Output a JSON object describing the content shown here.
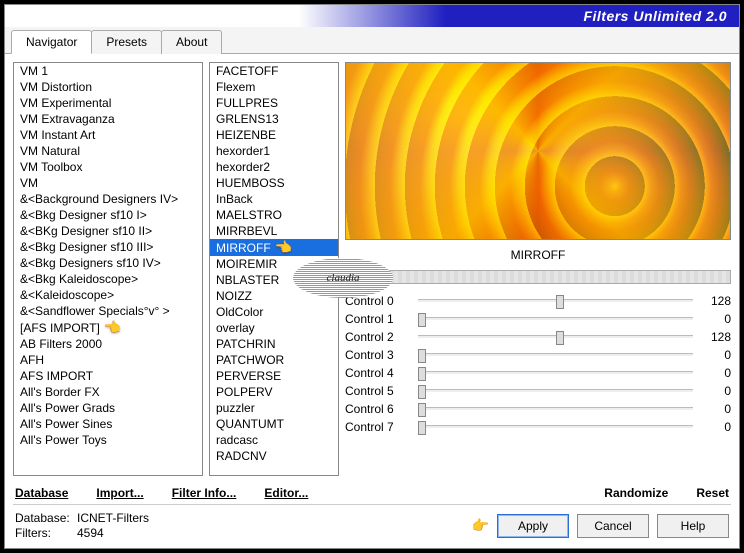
{
  "title": "Filters Unlimited 2.0",
  "tabs": {
    "navigator": "Navigator",
    "presets": "Presets",
    "about": "About"
  },
  "left_list": [
    "VM 1",
    "VM Distortion",
    "VM Experimental",
    "VM Extravaganza",
    "VM Instant Art",
    "VM Natural",
    "VM Toolbox",
    "VM",
    "&<Background Designers IV>",
    "&<Bkg Designer sf10 I>",
    "&<BKg Designer sf10 II>",
    "&<Bkg Designer sf10 III>",
    "&<Bkg Designers sf10 IV>",
    "&<Bkg Kaleidoscope>",
    "&<Kaleidoscope>",
    "&<Sandflower Specials°v° >",
    "[AFS IMPORT]",
    "AB Filters 2000",
    "AFH",
    "AFS IMPORT",
    "All's Border FX",
    "All's Power Grads",
    "All's Power Sines",
    "All's Power Toys"
  ],
  "left_pointer_index": 16,
  "mid_list": [
    "FACETOFF",
    "Flexem",
    "FULLPRES",
    "GRLENS13",
    "HEIZENBE",
    "hexorder1",
    "hexorder2",
    "HUEMBOSS",
    "InBack",
    "MAELSTRO",
    "MIRRBEVL",
    "MIRROFF",
    "MOIREMIR",
    "NBLASTER",
    "NOIZZ",
    "OldColor",
    "overlay",
    "PATCHRIN",
    "PATCHWOR",
    "PERVERSE",
    "POLPERV",
    "puzzler",
    "QUANTUMT",
    "radcasc",
    "RADCNV"
  ],
  "mid_selected_index": 11,
  "filter_name": "MIRROFF",
  "controls": [
    {
      "label": "Control 0",
      "value": 128,
      "pos": 50
    },
    {
      "label": "Control 1",
      "value": 0,
      "pos": 0
    },
    {
      "label": "Control 2",
      "value": 128,
      "pos": 50
    },
    {
      "label": "Control 3",
      "value": 0,
      "pos": 0
    },
    {
      "label": "Control 4",
      "value": 0,
      "pos": 0
    },
    {
      "label": "Control 5",
      "value": 0,
      "pos": 0
    },
    {
      "label": "Control 6",
      "value": 0,
      "pos": 0
    },
    {
      "label": "Control 7",
      "value": 0,
      "pos": 0
    }
  ],
  "linkbar": {
    "database": "Database",
    "import": "Import...",
    "filter_info": "Filter Info...",
    "editor": "Editor...",
    "randomize": "Randomize",
    "reset": "Reset"
  },
  "footer": {
    "db_key": "Database:",
    "db_val": "ICNET-Filters",
    "filters_key": "Filters:",
    "filters_val": "4594",
    "apply": "Apply",
    "cancel": "Cancel",
    "help": "Help"
  },
  "watermark": "claudia"
}
